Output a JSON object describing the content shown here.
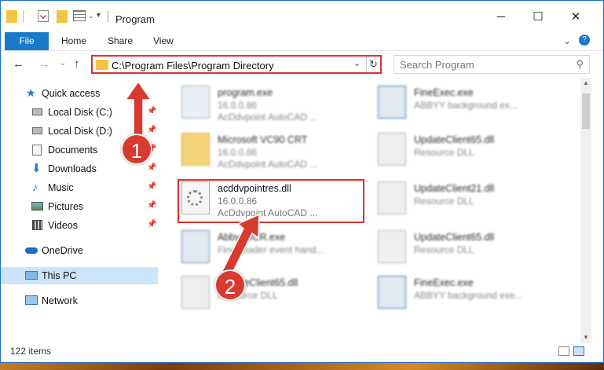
{
  "window": {
    "title": "Program",
    "controls": {
      "minimize": "─",
      "maximize": "☐",
      "close": "✕"
    }
  },
  "ribbon": {
    "tabs": [
      "File",
      "Home",
      "Share",
      "View"
    ],
    "chevron": "⌄",
    "help": "?"
  },
  "navbar": {
    "back": "←",
    "forward": "→",
    "recent": "⌄",
    "up": "↑",
    "address": "C:\\Program Files\\Program Directory",
    "refresh": "↻",
    "dropdown": "⌄",
    "search_placeholder": "Search Program",
    "search_icon": "⚲"
  },
  "sidebar": {
    "items": [
      {
        "label": "Quick access",
        "icon": "star-icon",
        "pinned": false
      },
      {
        "label": "Local Disk (C:)",
        "icon": "drive-icon",
        "pinned": true
      },
      {
        "label": "Local Disk (D:)",
        "icon": "drive-icon",
        "pinned": true
      },
      {
        "label": "Documents",
        "icon": "documents-icon",
        "pinned": true
      },
      {
        "label": "Downloads",
        "icon": "download-icon",
        "pinned": true
      },
      {
        "label": "Music",
        "icon": "music-icon",
        "pinned": true
      },
      {
        "label": "Pictures",
        "icon": "pictures-icon",
        "pinned": true
      },
      {
        "label": "Videos",
        "icon": "videos-icon",
        "pinned": true
      },
      {
        "label": "OneDrive",
        "icon": "cloud-icon",
        "pinned": false
      },
      {
        "label": "This PC",
        "icon": "computer-icon",
        "pinned": false
      },
      {
        "label": "Network",
        "icon": "network-icon",
        "pinned": false
      }
    ],
    "pin_glyph": "📌"
  },
  "files": [
    {
      "name": "program.exe",
      "l2": "16.0.0.86",
      "l3": "AcDdvpoint AutoCAD ...",
      "type": "exe",
      "blurred": true
    },
    {
      "name": "Microsoft VC90 CRT",
      "l2": "16.0.0.86",
      "l3": "AcDdvpoint AutoCAD ...",
      "type": "folder",
      "blurred": true
    },
    {
      "name": "acddvpointres.dll",
      "l2": "16.0.0.86",
      "l3": "AcDdvpoint AutoCAD ...",
      "type": "dll",
      "blurred": false
    },
    {
      "name": "AbbyyOCR.exe",
      "l2": "FineReader event hand...",
      "l3": "",
      "type": "exe2",
      "blurred": true
    },
    {
      "name": "UpdateClient65.dll",
      "l2": "Resource DLL",
      "l3": "",
      "type": "dll",
      "blurred": true
    },
    {
      "name": "FineExec.exe",
      "l2": "ABBYY background ex...",
      "l3": "",
      "type": "exe2",
      "blurred": true
    },
    {
      "name": "UpdateClient65.dll",
      "l2": "Resource DLL",
      "l3": "",
      "type": "dll",
      "blurred": true
    },
    {
      "name": "UpdateClient21.dll",
      "l2": "Resource DLL",
      "l3": "",
      "type": "dll",
      "blurred": true
    },
    {
      "name": "UpdateClient65.dll",
      "l2": "Resource DLL",
      "l3": "",
      "type": "dll",
      "blurred": true
    },
    {
      "name": "FineExec.exe",
      "l2": "ABBYY background exe...",
      "l3": "",
      "type": "exe2",
      "blurred": true
    }
  ],
  "status": {
    "item_count": "122 items"
  },
  "annotations": {
    "step1": "1",
    "step2": "2",
    "color": "#d93a30"
  }
}
